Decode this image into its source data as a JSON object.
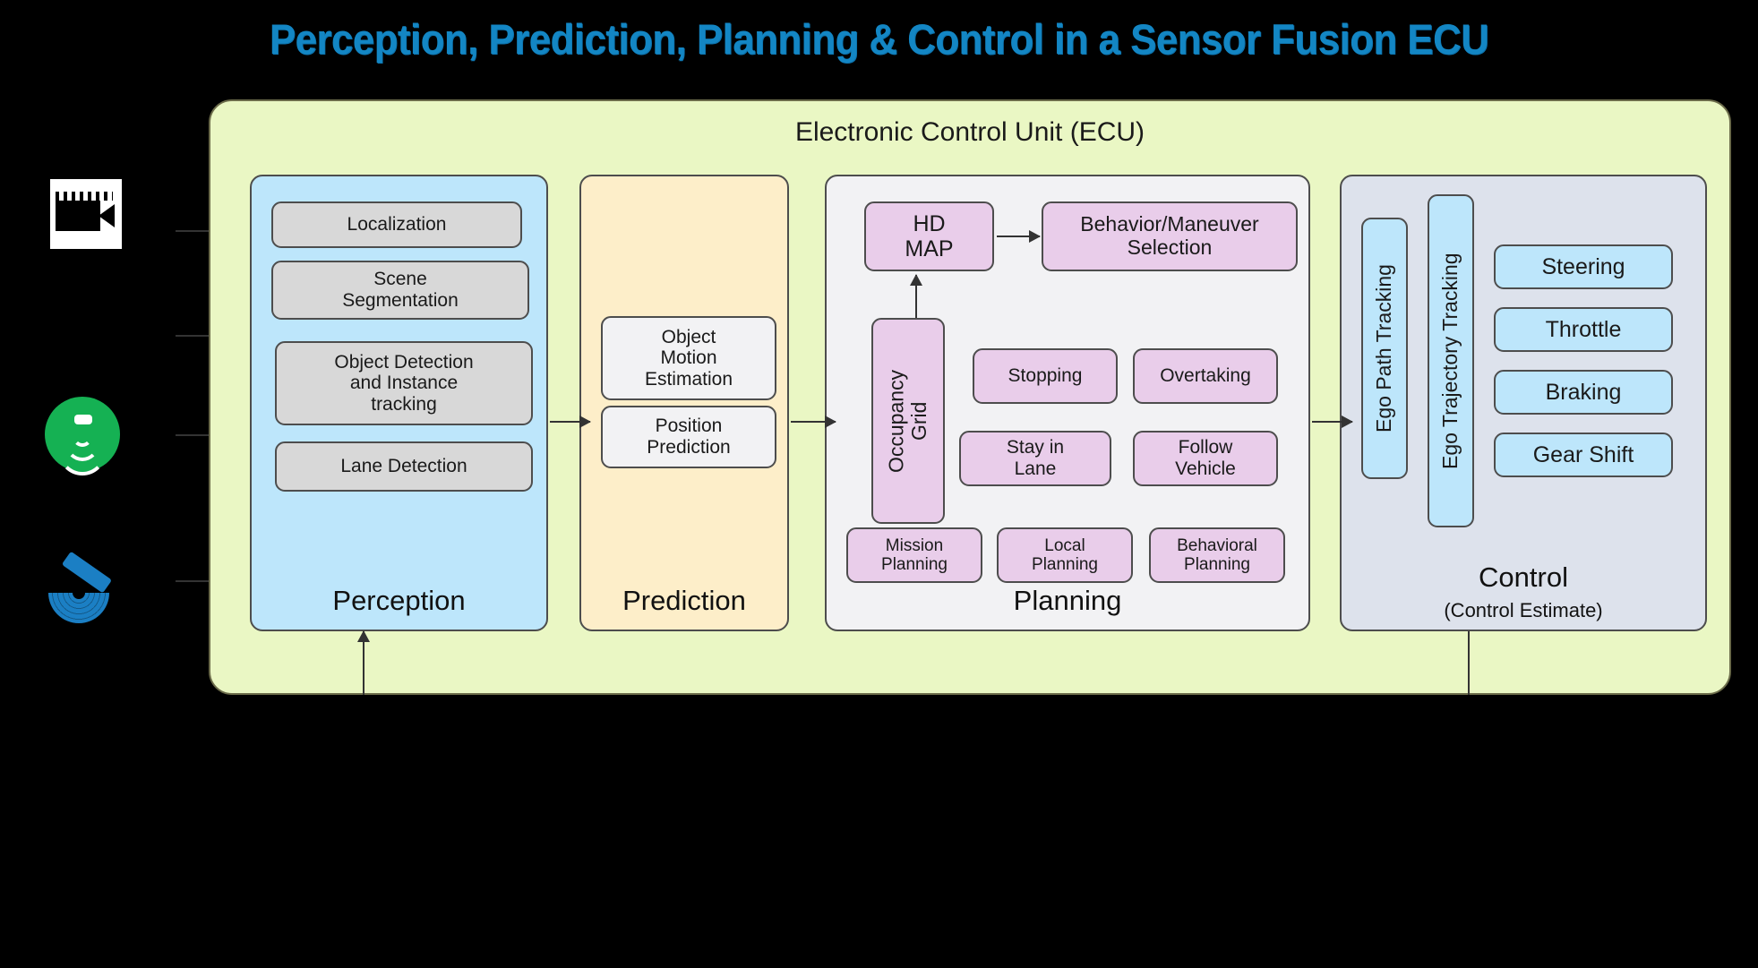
{
  "page": {
    "title": "Perception, Prediction, Planning & Control in a Sensor Fusion  ECU",
    "title_color": "#1386c4",
    "background": "#000000"
  },
  "sensors": [
    {
      "name": "camera-sensor",
      "icon": "camera-icon",
      "color": "#ffffff"
    },
    {
      "name": "radar-sensor",
      "icon": "radar-wave-icon",
      "color": "#15b153"
    },
    {
      "name": "lidar-sensor",
      "icon": "lidar-scan-icon",
      "color": "#1b7fc4"
    }
  ],
  "ecu": {
    "title": "Electronic Control Unit (ECU)",
    "background": "#eaf7c4",
    "border": "#6b6b4a"
  },
  "perception": {
    "label": "Perception",
    "background": "#bde6fb",
    "items": [
      {
        "label": "Localization"
      },
      {
        "label": "Scene\nSegmentation"
      },
      {
        "label": "Object Detection\nand Instance\ntracking"
      },
      {
        "label": "Lane Detection"
      }
    ]
  },
  "prediction": {
    "label": "Prediction",
    "background": "#fdeec9",
    "items": [
      {
        "label": "Object\nMotion\nEstimation"
      },
      {
        "label": "Position\nPrediction"
      }
    ]
  },
  "planning": {
    "label": "Planning",
    "background": "#f2f2f4",
    "chip_color": "#e9cdea",
    "hd_map": "HD\nMAP",
    "behavior_selection": "Behavior/Maneuver\nSelection",
    "occupancy_grid": "Occupancy\nGrid",
    "maneuvers": [
      {
        "label": "Stopping"
      },
      {
        "label": "Overtaking"
      },
      {
        "label": "Stay in\nLane"
      },
      {
        "label": "Follow\nVehicle"
      }
    ],
    "planners": [
      {
        "label": "Mission\nPlanning"
      },
      {
        "label": "Local\nPlanning"
      },
      {
        "label": "Behavioral\nPlanning"
      }
    ]
  },
  "control": {
    "label": "Control",
    "sublabel": "(Control Estimate)",
    "background": "#dde2ec",
    "chip_color": "#bde6fb",
    "trackers": [
      {
        "label": "Ego Path Tracking"
      },
      {
        "label": "Ego Trajectory Tracking"
      }
    ],
    "actuators": [
      {
        "label": "Steering"
      },
      {
        "label": "Throttle"
      },
      {
        "label": "Braking"
      },
      {
        "label": "Gear Shift"
      }
    ]
  }
}
